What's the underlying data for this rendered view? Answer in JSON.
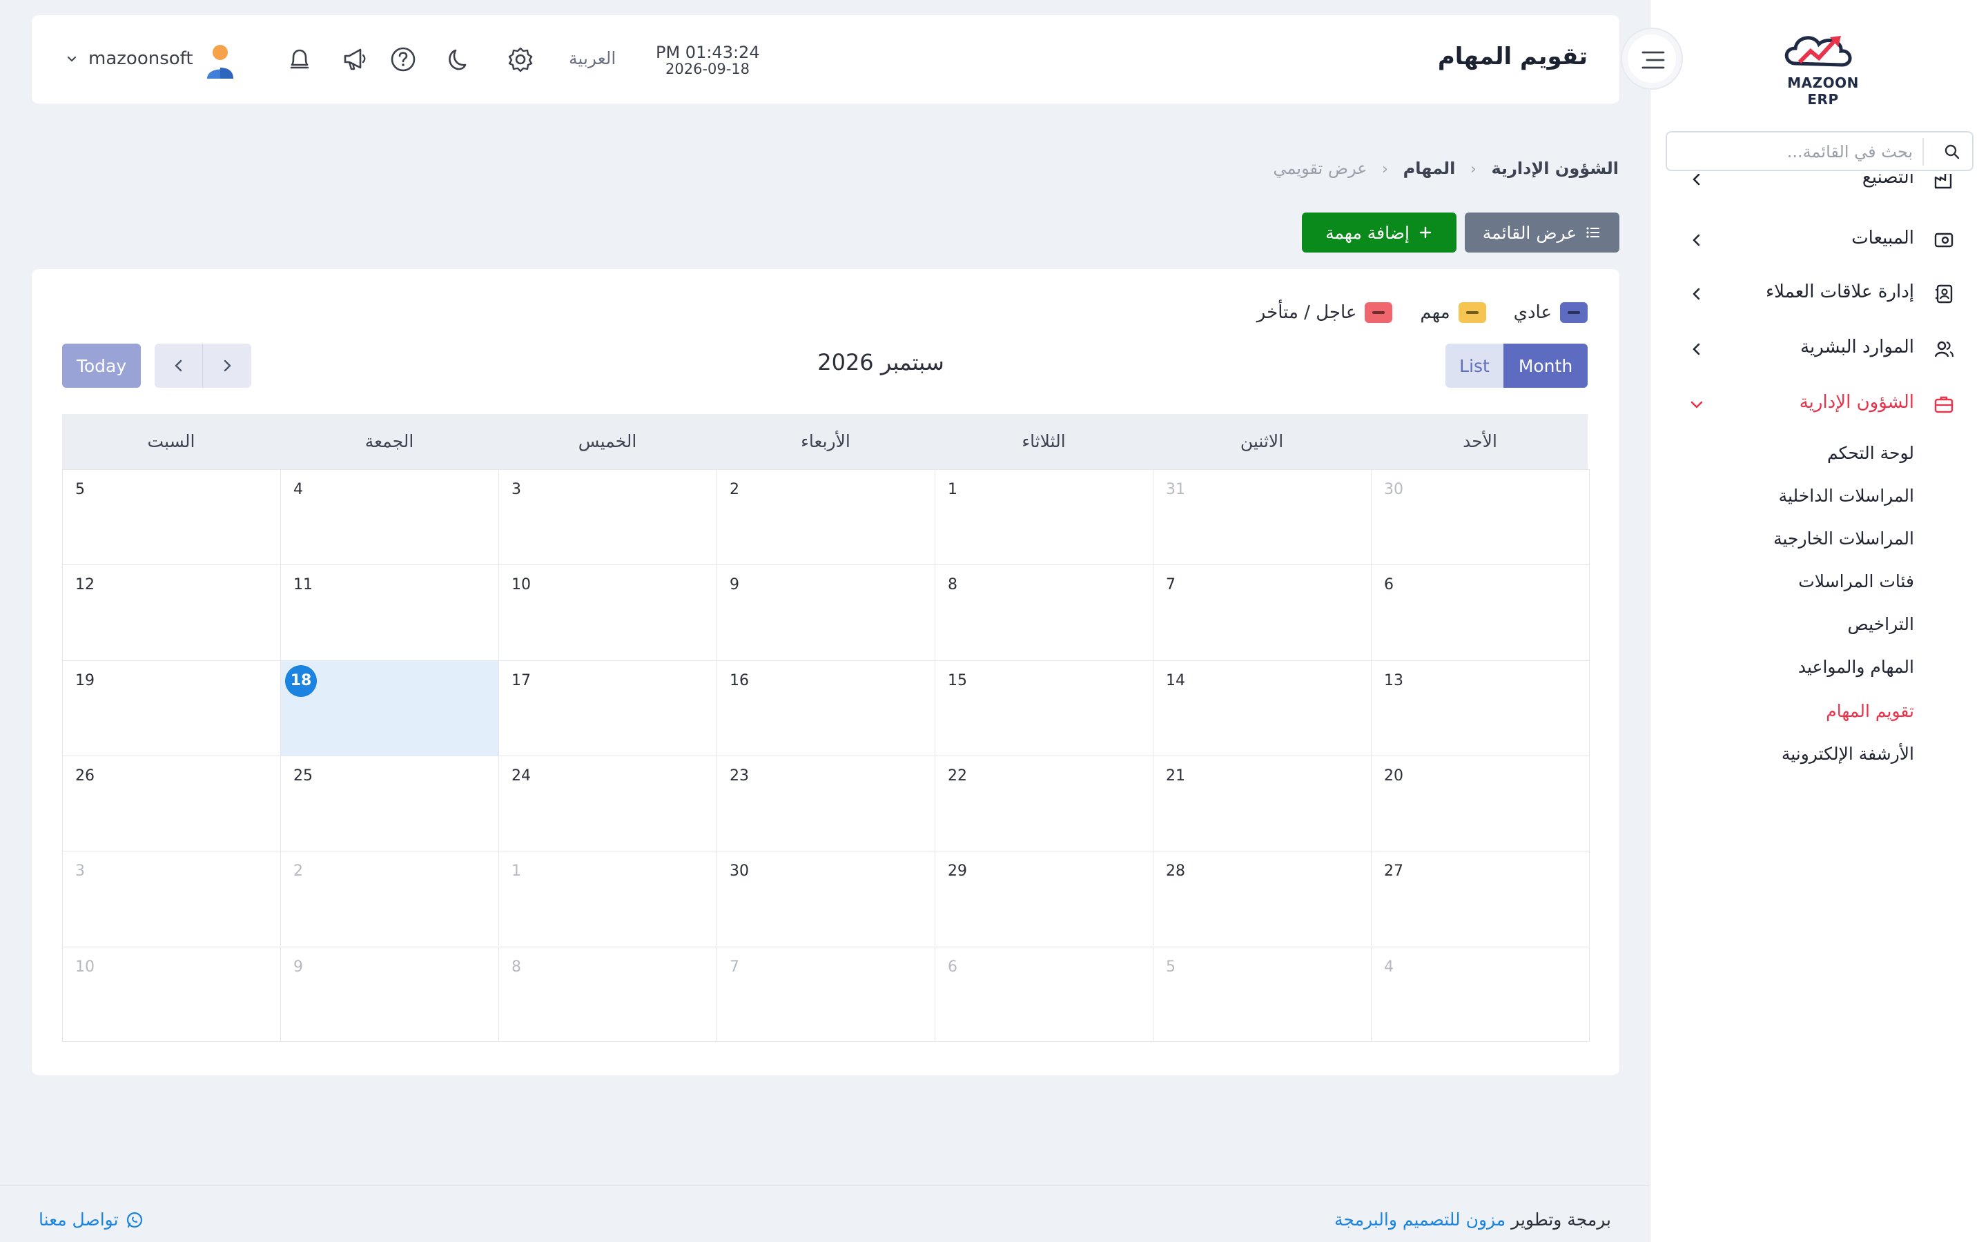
{
  "brand": {
    "logo_text": "MAZOON ERP",
    "accent": "#e8334a"
  },
  "header": {
    "title": "تقويم المهام",
    "clock_time": "PM 01:43:24",
    "clock_date": "2026-09-18",
    "language": "العربية",
    "user_name": "mazoonsoft",
    "icons": [
      "menu-collapse-icon",
      "gear-icon",
      "moon-icon",
      "help-icon",
      "megaphone-icon",
      "bell-icon",
      "avatar",
      "chevron-down-icon"
    ]
  },
  "sidebar": {
    "search_placeholder": "بحث في القائمة...",
    "items": [
      {
        "label": "التصنيع",
        "icon": "factory-icon"
      },
      {
        "label": "المبيعات",
        "icon": "sales-icon"
      },
      {
        "label": "إدارة علاقات العملاء",
        "icon": "contacts-icon"
      },
      {
        "label": "الموارد البشرية",
        "icon": "users-icon"
      },
      {
        "label": "الشؤون الإدارية",
        "icon": "briefcase-icon",
        "active": true
      }
    ],
    "subitems": [
      {
        "label": "لوحة التحكم"
      },
      {
        "label": "المراسلات الداخلية"
      },
      {
        "label": "المراسلات الخارجية"
      },
      {
        "label": "فئات المراسلات"
      },
      {
        "label": "التراخيص"
      },
      {
        "label": "المهام والمواعيد"
      },
      {
        "label": "تقويم المهام",
        "active": true
      },
      {
        "label": "الأرشفة الإلكترونية"
      }
    ]
  },
  "breadcrumb": {
    "items": [
      "الشؤون الإدارية",
      "المهام",
      "عرض تقويمي"
    ],
    "separator": "‹"
  },
  "actions": {
    "list_view": "عرض القائمة",
    "add_task": "إضافة مهمة",
    "add_color": "#0b8a1c",
    "list_color": "#6c7789"
  },
  "calendar": {
    "legend": [
      {
        "label": "عادي",
        "color": "#5d6bc0"
      },
      {
        "label": "مهم",
        "color": "#f5c451"
      },
      {
        "label": "عاجل / متأخر",
        "color": "#f0666e"
      }
    ],
    "view_list": "List",
    "view_month": "Month",
    "title": "سبتمبر 2026",
    "today_label": "Today",
    "weekdays": [
      "الأحد",
      "الاثنين",
      "الثلاثاء",
      "الأربعاء",
      "الخميس",
      "الجمعة",
      "السبت"
    ],
    "weeks": [
      [
        "30",
        "31",
        "1",
        "2",
        "3",
        "4",
        "5"
      ],
      [
        "6",
        "7",
        "8",
        "9",
        "10",
        "11",
        "12"
      ],
      [
        "13",
        "14",
        "15",
        "16",
        "17",
        "18",
        "19"
      ],
      [
        "20",
        "21",
        "22",
        "23",
        "24",
        "25",
        "26"
      ],
      [
        "27",
        "28",
        "29",
        "30",
        "1",
        "2",
        "3"
      ],
      [
        "4",
        "5",
        "6",
        "7",
        "8",
        "9",
        "10"
      ]
    ],
    "other_month": [
      [
        true,
        true,
        false,
        false,
        false,
        false,
        false
      ],
      [
        false,
        false,
        false,
        false,
        false,
        false,
        false
      ],
      [
        false,
        false,
        false,
        false,
        false,
        false,
        false
      ],
      [
        false,
        false,
        false,
        false,
        false,
        false,
        false
      ],
      [
        false,
        false,
        false,
        false,
        true,
        true,
        true
      ],
      [
        true,
        true,
        true,
        true,
        true,
        true,
        true
      ]
    ],
    "today": "18",
    "today_color": "#1b84e0"
  },
  "footer": {
    "credit_prefix": "برمجة وتطوير",
    "credit_link": "مزون للتصميم والبرمجة",
    "contact": "تواصل معنا"
  }
}
